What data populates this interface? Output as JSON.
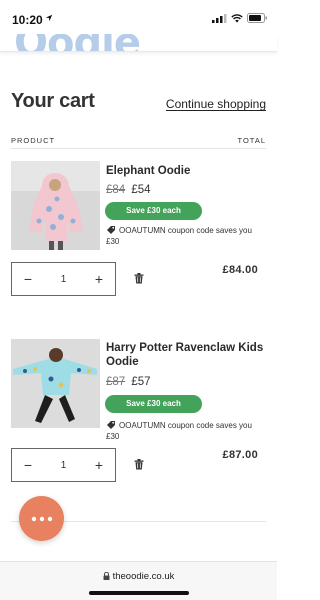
{
  "status_bar": {
    "time": "10:20"
  },
  "header": {
    "logo_text": "Oodie"
  },
  "cart": {
    "title": "Your cart",
    "continue_label": "Continue shopping",
    "col_product": "PRODUCT",
    "col_total": "TOTAL",
    "items": [
      {
        "name": "Elephant Oodie",
        "price_old": "£84",
        "price_new": "£54",
        "save_label": "Save £30 each",
        "coupon_text": "OOAUTUMN coupon code saves you £30",
        "quantity": "1",
        "qty_minus": "−",
        "qty_plus": "+",
        "line_total": "£84.00"
      },
      {
        "name": "Harry Potter Ravenclaw Kids Oodie",
        "price_old": "£87",
        "price_new": "£57",
        "save_label": "Save £30 each",
        "coupon_text": "OOAUTUMN coupon code saves you £30",
        "quantity": "1",
        "qty_minus": "−",
        "qty_plus": "+",
        "line_total": "£87.00"
      }
    ]
  },
  "browser": {
    "url": "theoodie.co.uk"
  },
  "colors": {
    "accent_green": "#44a35a",
    "chat_orange": "#e8815f",
    "logo_blue": "#b6cdea"
  }
}
